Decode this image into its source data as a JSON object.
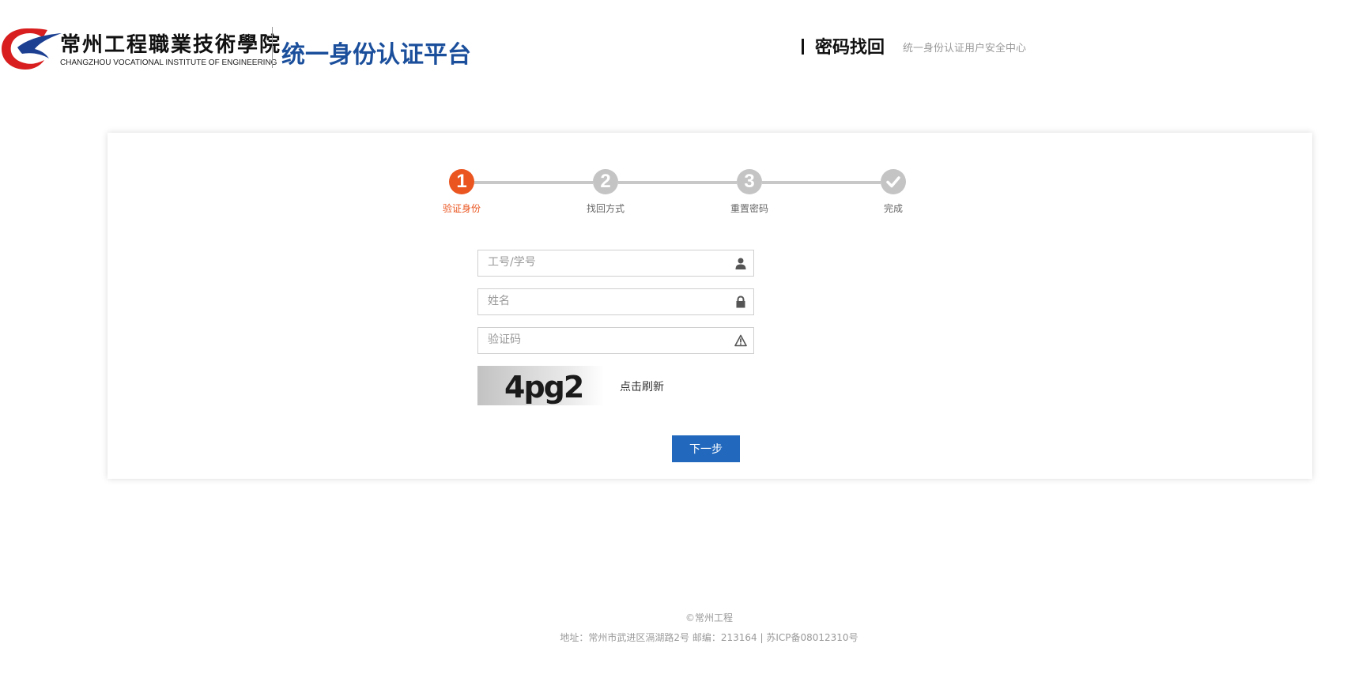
{
  "header": {
    "logo": {
      "name_cn": "常州工程職業技術學院",
      "name_en": "CHANGZHOU VOCATIONAL INSTITUTE OF ENGINEERING"
    },
    "platform_title": "统一身份认证平台",
    "page_heading": "密码找回",
    "page_subheading": "统一身份认证用户安全中心"
  },
  "steps": [
    {
      "number": "1",
      "label": "验证身份",
      "state": "active"
    },
    {
      "number": "2",
      "label": "找回方式",
      "state": "pending"
    },
    {
      "number": "3",
      "label": "重置密码",
      "state": "pending"
    },
    {
      "number": "",
      "label": "完成",
      "state": "pending",
      "icon": "checkmark-icon"
    }
  ],
  "form": {
    "id_field": {
      "placeholder": "工号/学号",
      "value": "",
      "icon": "user-icon"
    },
    "name_field": {
      "placeholder": "姓名",
      "value": "",
      "icon": "lock-icon"
    },
    "captcha_field": {
      "placeholder": "验证码",
      "value": "",
      "icon": "warning-icon"
    },
    "captcha_text": "4pg2",
    "refresh_label": "点击刷新",
    "next_button": "下一步"
  },
  "footer": {
    "copyright": "©常州工程",
    "address": "地址：常州市武进区滆湖路2号   邮编：213164 | 苏ICP备08012310号"
  },
  "colors": {
    "accent": "#ea5520",
    "brand": "#1b4f9c",
    "button": "#2269be",
    "step_inactive": "#c4c4c4"
  }
}
